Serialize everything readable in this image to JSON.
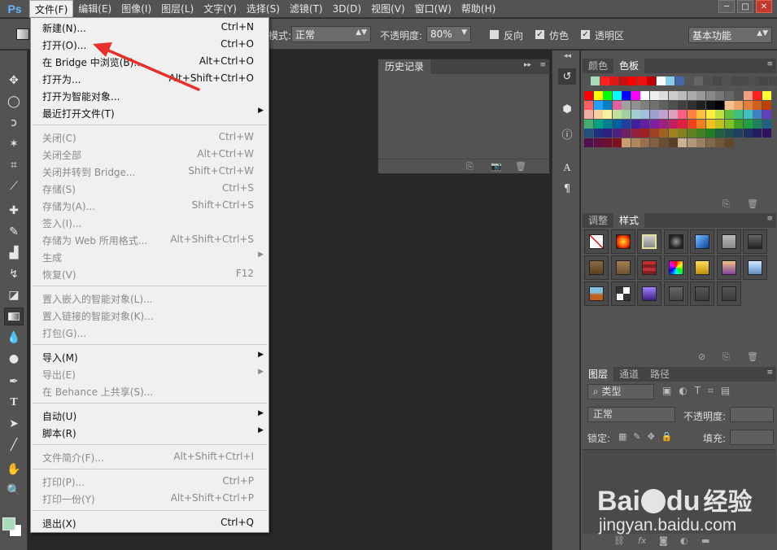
{
  "app": {
    "logo": "Ps"
  },
  "menubar": {
    "items": [
      "文件(F)",
      "编辑(E)",
      "图像(I)",
      "图层(L)",
      "文字(Y)",
      "选择(S)",
      "滤镜(T)",
      "3D(D)",
      "视图(V)",
      "窗口(W)",
      "帮助(H)"
    ]
  },
  "window_controls": {
    "minimize": "─",
    "restore": "□",
    "close": "✕"
  },
  "options": {
    "mode_label": "模式:",
    "mode_value": "正常",
    "opacity_label": "不透明度:",
    "opacity_value": "80%",
    "reverse_label": "反向",
    "dither_label": "仿色",
    "transparency_label": "透明区",
    "workspace_value": "基本功能"
  },
  "file_menu": {
    "items": [
      {
        "label": "新建(N)...",
        "shortcut": "Ctrl+N",
        "disabled": false,
        "submenu": false
      },
      {
        "label": "打开(O)...",
        "shortcut": "Ctrl+O",
        "disabled": false,
        "submenu": false
      },
      {
        "label": "在 Bridge 中浏览(B)...",
        "shortcut": "Alt+Ctrl+O",
        "disabled": false,
        "submenu": false
      },
      {
        "label": "打开为...",
        "shortcut": "Alt+Shift+Ctrl+O",
        "disabled": false,
        "submenu": false
      },
      {
        "label": "打开为智能对象...",
        "shortcut": "",
        "disabled": false,
        "submenu": false
      },
      {
        "label": "最近打开文件(T)",
        "shortcut": "",
        "disabled": false,
        "submenu": true
      },
      {
        "label": "关闭(C)",
        "shortcut": "Ctrl+W",
        "disabled": true,
        "submenu": false
      },
      {
        "label": "关闭全部",
        "shortcut": "Alt+Ctrl+W",
        "disabled": true,
        "submenu": false
      },
      {
        "label": "关闭并转到 Bridge...",
        "shortcut": "Shift+Ctrl+W",
        "disabled": true,
        "submenu": false
      },
      {
        "label": "存储(S)",
        "shortcut": "Ctrl+S",
        "disabled": true,
        "submenu": false
      },
      {
        "label": "存储为(A)...",
        "shortcut": "Shift+Ctrl+S",
        "disabled": true,
        "submenu": false
      },
      {
        "label": "签入(I)...",
        "shortcut": "",
        "disabled": true,
        "submenu": false
      },
      {
        "label": "存储为 Web 所用格式...",
        "shortcut": "Alt+Shift+Ctrl+S",
        "disabled": true,
        "submenu": false
      },
      {
        "label": "生成",
        "shortcut": "",
        "disabled": true,
        "submenu": true
      },
      {
        "label": "恢复(V)",
        "shortcut": "F12",
        "disabled": true,
        "submenu": false
      },
      {
        "label": "置入嵌入的智能对象(L)...",
        "shortcut": "",
        "disabled": true,
        "submenu": false
      },
      {
        "label": "置入链接的智能对象(K)...",
        "shortcut": "",
        "disabled": true,
        "submenu": false
      },
      {
        "label": "打包(G)...",
        "shortcut": "",
        "disabled": true,
        "submenu": false
      },
      {
        "label": "导入(M)",
        "shortcut": "",
        "disabled": false,
        "submenu": true
      },
      {
        "label": "导出(E)",
        "shortcut": "",
        "disabled": true,
        "submenu": true
      },
      {
        "label": "在 Behance 上共享(S)...",
        "shortcut": "",
        "disabled": true,
        "submenu": false
      },
      {
        "label": "自动(U)",
        "shortcut": "",
        "disabled": false,
        "submenu": true
      },
      {
        "label": "脚本(R)",
        "shortcut": "",
        "disabled": false,
        "submenu": true
      },
      {
        "label": "文件简介(F)...",
        "shortcut": "Alt+Shift+Ctrl+I",
        "disabled": true,
        "submenu": false
      },
      {
        "label": "打印(P)...",
        "shortcut": "Ctrl+P",
        "disabled": true,
        "submenu": false
      },
      {
        "label": "打印一份(Y)",
        "shortcut": "Alt+Shift+Ctrl+P",
        "disabled": true,
        "submenu": false
      },
      {
        "label": "退出(X)",
        "shortcut": "Ctrl+Q",
        "disabled": false,
        "submenu": false
      }
    ]
  },
  "history_panel": {
    "title": "历史记录"
  },
  "color_panel": {
    "tabs": [
      "颜色",
      "色板"
    ],
    "active": 1
  },
  "styles_panel": {
    "tabs": [
      "调整",
      "样式"
    ],
    "active": 1
  },
  "layers_panel": {
    "tabs": [
      "图层",
      "通道",
      "路径"
    ],
    "active": 0,
    "filter_label": "类型",
    "blend_mode": "正常",
    "opacity_label": "不透明度:",
    "lock_label": "锁定:",
    "fill_label": "填充:"
  },
  "dock": {
    "text_icon": "A",
    "para_icon": "¶"
  },
  "colors": {
    "accent_blue": "#62b6ff",
    "arrow_red": "#e8302a",
    "menu_bg": "#f0f0f0",
    "ui_gray": "#535353",
    "canvas_dark": "#282828"
  },
  "watermark": {
    "brand": "Bai",
    "brand2": "du",
    "jingyan": "经验",
    "url": "jingyan.baidu.com"
  }
}
